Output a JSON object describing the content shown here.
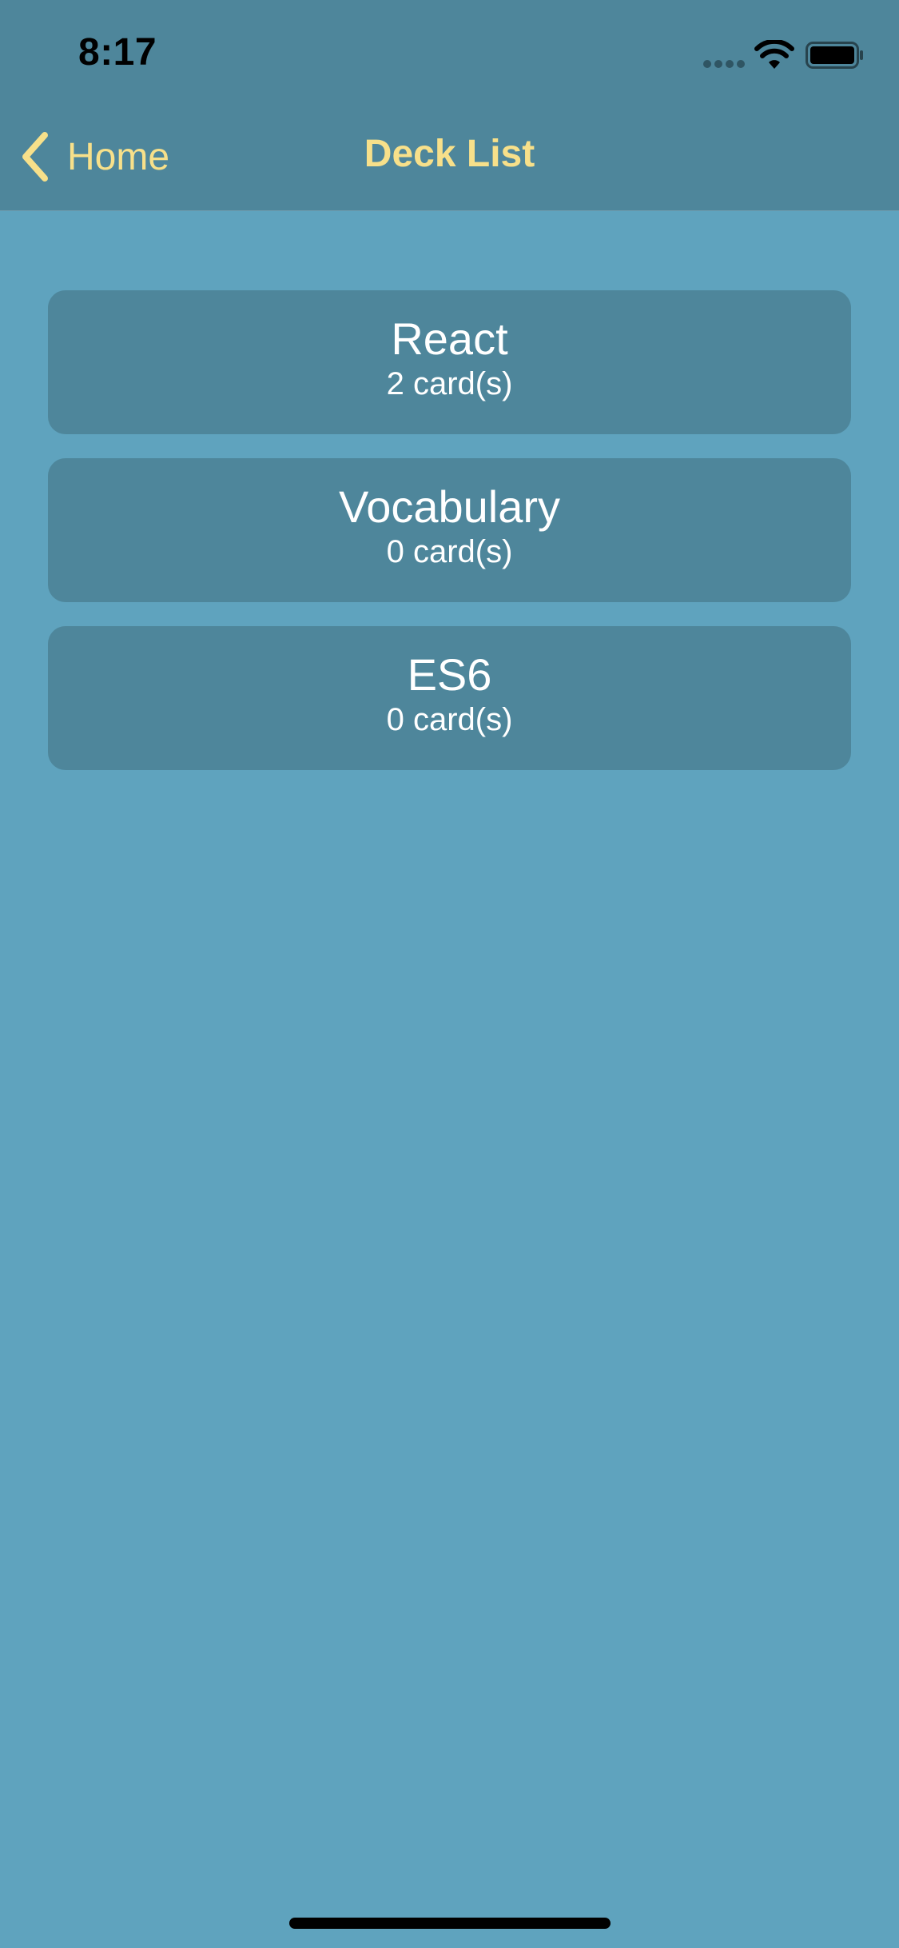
{
  "status_bar": {
    "time": "8:17",
    "icons": [
      "signal-dots-icon",
      "wifi-icon",
      "battery-icon"
    ]
  },
  "nav": {
    "back_label": "Home",
    "back_icon": "chevron-left-icon",
    "title": "Deck List"
  },
  "decks": [
    {
      "title": "React",
      "count": "2 card(s)"
    },
    {
      "title": "Vocabulary",
      "count": "0 card(s)"
    },
    {
      "title": "ES6",
      "count": "0 card(s)"
    }
  ],
  "colors": {
    "background": "#5FA3BE",
    "header": "#4E869B",
    "card": "#4E869B",
    "accent": "#F7E08A",
    "card_text": "#FFFFFF"
  }
}
